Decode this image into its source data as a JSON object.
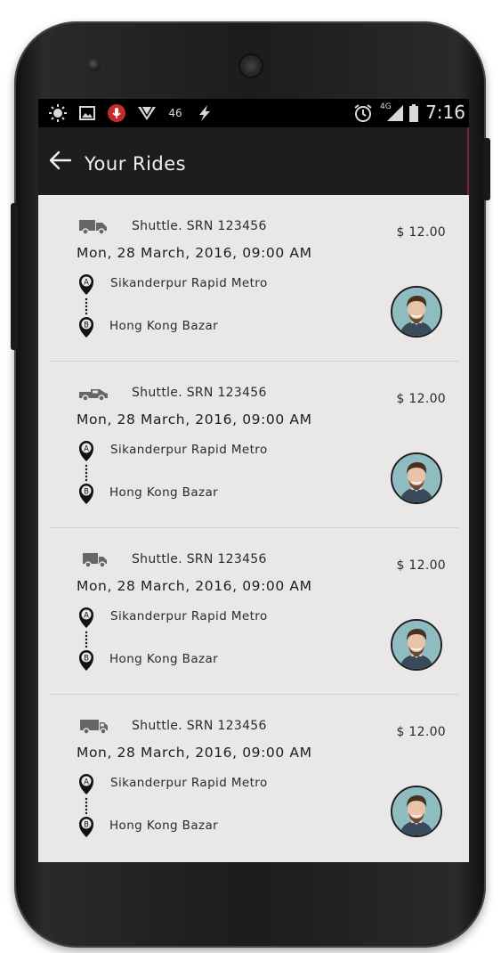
{
  "status_bar": {
    "icons": [
      "brightness-icon",
      "image-icon",
      "mic-icon",
      "signal-wedge-icon",
      "network-46-icon",
      "bolt-icon",
      "alarm-icon",
      "signal-4g-icon",
      "battery-icon"
    ],
    "network_label": "46",
    "lte_label": "4G",
    "time": "7:16"
  },
  "app_bar": {
    "title": "Your Rides"
  },
  "rides": [
    {
      "vehicle": "Shuttle. SRN 123456",
      "price": "$ 12.00",
      "datetime": "Mon, 28 March, 2016, 09:00 AM",
      "marker_a": "A",
      "marker_b": "B",
      "from": "Sikanderpur Rapid Metro",
      "to": "Hong Kong Bazar",
      "vehicle_icon": "van-icon"
    },
    {
      "vehicle": "Shuttle. SRN 123456",
      "price": "$ 12.00",
      "datetime": "Mon, 28 March, 2016, 09:00 AM",
      "marker_a": "A",
      "marker_b": "B",
      "from": "Sikanderpur Rapid Metro",
      "to": "Hong Kong Bazar",
      "vehicle_icon": "pickup-icon"
    },
    {
      "vehicle": "Shuttle. SRN 123456",
      "price": "$ 12.00",
      "datetime": "Mon, 28 March, 2016, 09:00 AM",
      "marker_a": "A",
      "marker_b": "B",
      "from": "Sikanderpur Rapid Metro",
      "to": "Hong Kong Bazar",
      "vehicle_icon": "truck-icon"
    },
    {
      "vehicle": "Shuttle. SRN 123456",
      "price": "$ 12.00",
      "datetime": "Mon, 28 March, 2016, 09:00 AM",
      "marker_a": "A",
      "marker_b": "B",
      "from": "Sikanderpur Rapid Metro",
      "to": "Hong Kong Bazar",
      "vehicle_icon": "delivery-truck-icon"
    }
  ],
  "colors": {
    "app_bar": "#1f1c1d",
    "list_background": "#e9e7e8",
    "avatar_background": "#8fbcc0",
    "accent_edge": "#7a1e3a"
  }
}
